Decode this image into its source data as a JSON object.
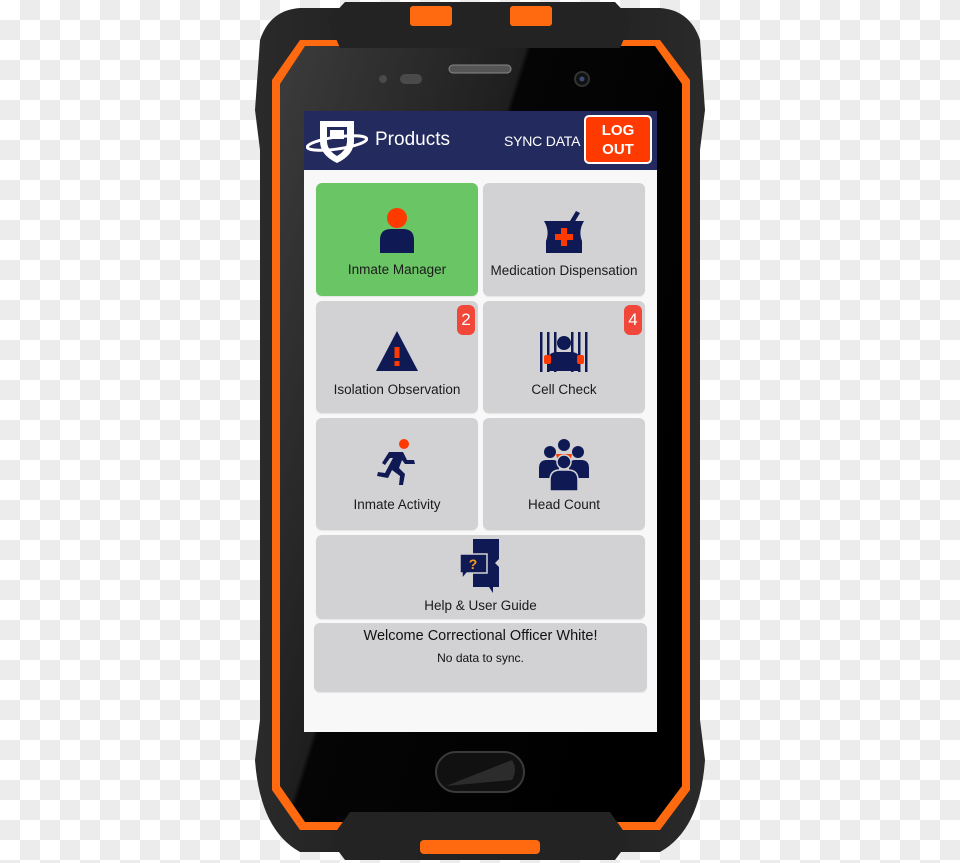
{
  "colors": {
    "header_bg": "#232b5e",
    "logout_bg": "#ff3a00",
    "active_tile": "#6ac665",
    "tile_bg": "#d2d2d4",
    "badge_bg": "#f0473a",
    "icon_navy": "#0f1a55",
    "icon_accent": "#ff3a00",
    "frame_orange": "#ff6a10"
  },
  "header": {
    "logo_icon": "shield-logo-icon",
    "title": "Products",
    "sync_label": "SYNC DATA",
    "logout_line1": "LOG",
    "logout_line2": "OUT"
  },
  "tiles": [
    {
      "label": "Inmate Manager",
      "icon": "person-icon",
      "active": true,
      "badge": null
    },
    {
      "label": "Medication Dispensation",
      "icon": "mortar-pestle-icon",
      "active": false,
      "badge": null
    },
    {
      "label": "Isolation Observation",
      "icon": "warning-triangle-icon",
      "active": false,
      "badge": "2"
    },
    {
      "label": "Cell Check",
      "icon": "jail-cell-icon",
      "active": false,
      "badge": "4"
    },
    {
      "label": "Inmate Activity",
      "icon": "running-person-icon",
      "active": false,
      "badge": null
    },
    {
      "label": "Head Count",
      "icon": "group-icon",
      "active": false,
      "badge": null
    },
    {
      "label": "Help & User Guide",
      "icon": "chat-help-icon",
      "active": false,
      "badge": null
    }
  ],
  "welcome": {
    "title": "Welcome Correctional Officer White!",
    "status": "No data to sync."
  }
}
